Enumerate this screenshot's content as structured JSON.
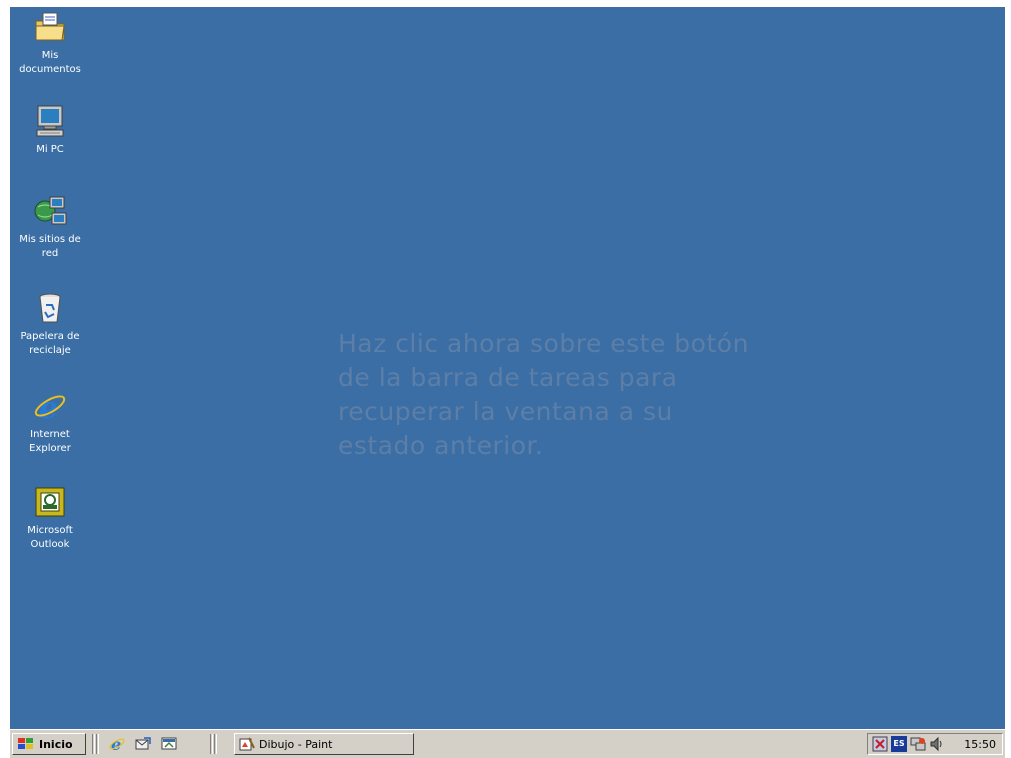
{
  "desktop": {
    "background_color": "#3a6ea5",
    "icons": [
      {
        "label": "Mis\ndocumentos",
        "icon": "folder-icon"
      },
      {
        "label": "Mi PC",
        "icon": "computer-icon"
      },
      {
        "label": "Mis sitios de\nred",
        "icon": "network-icon"
      },
      {
        "label": "Papelera de\nreciclaje",
        "icon": "recycle-bin-icon"
      },
      {
        "label": "Internet\nExplorer",
        "icon": "internet-explorer-icon"
      },
      {
        "label": "Microsoft\nOutlook",
        "icon": "outlook-icon"
      }
    ],
    "instruction_text": "Haz clic ahora sobre este botón de la barra de tareas para recuperar la ventana a su estado anterior."
  },
  "taskbar": {
    "start_label": "Inicio",
    "quick_launch": [
      "internet-explorer-icon",
      "outlook-express-icon",
      "show-desktop-icon"
    ],
    "task_button_label": "Dibujo - Paint",
    "tray_icons": [
      "antivirus-icon",
      "language-es-icon",
      "network-tray-icon",
      "volume-icon"
    ],
    "language_indicator": "ES",
    "clock": "15:50"
  }
}
